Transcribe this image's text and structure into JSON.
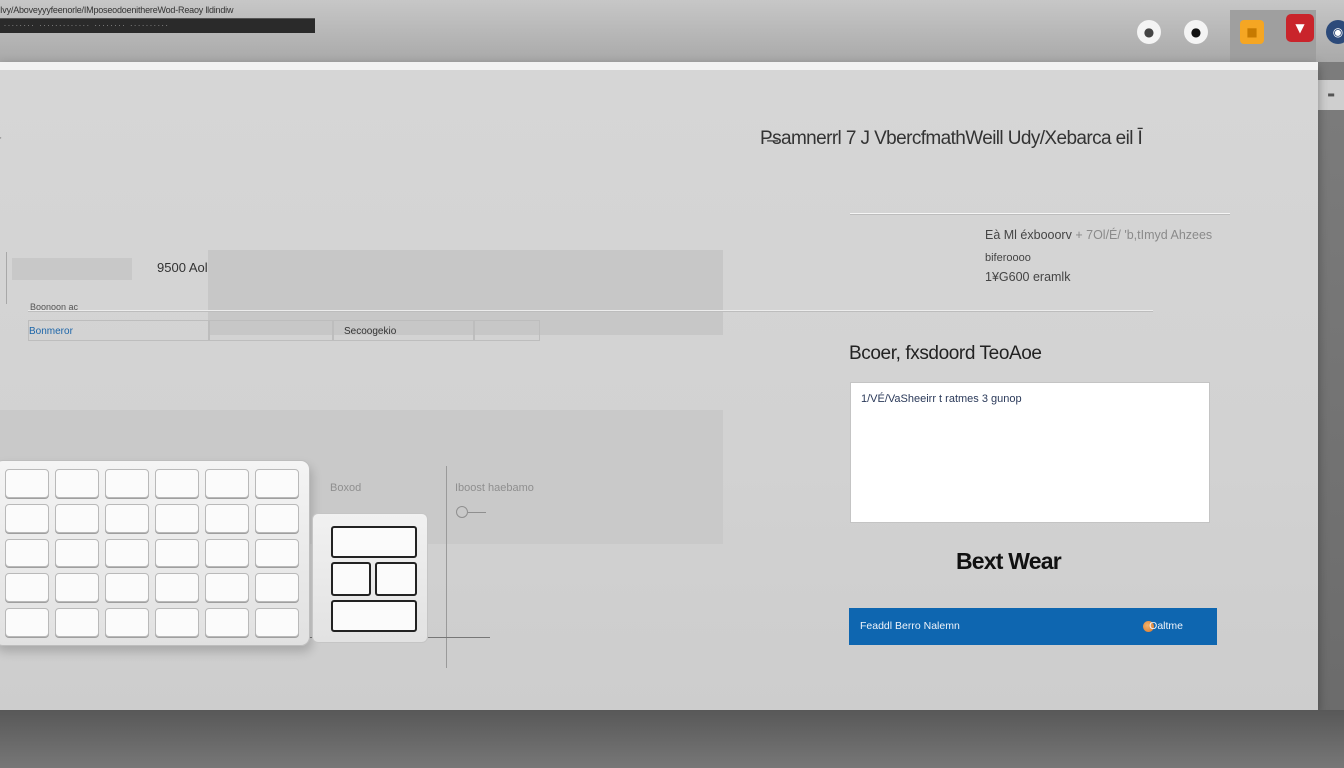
{
  "titlebar": {
    "title": "Ivy/Aboveyyyfeenorle/IMposeodoenithereWod-Reaoy lldindiw",
    "subtitle": "........ ............. ........ .........."
  },
  "tray": {
    "icons": [
      {
        "name": "chat-icon",
        "glyph": "●",
        "bg": "#f4f4f4",
        "fg": "#444"
      },
      {
        "name": "profile-icon",
        "glyph": "●",
        "bg": "#f4f4f4",
        "fg": "#111"
      },
      {
        "name": "package-icon",
        "glyph": "■",
        "bg": "#f5a623",
        "fg": "#c77a00"
      },
      {
        "name": "shield-icon",
        "glyph": "▼",
        "bg": "#c9242b",
        "fg": "#ffffff"
      },
      {
        "name": "eye-icon",
        "glyph": "◉",
        "bg": "#2c4a7a",
        "fg": "#ffffff"
      }
    ],
    "side_tab": "▬"
  },
  "window": {
    "heading": "P̶samnerrl  7 J  VbercfmathWeill Udy/Xebarca  eil  Ī",
    "edge_mark": "'"
  },
  "info": {
    "line1": "Eà Ml éxbooorv",
    "line1_faded": "+  7Ol/É/ 'b,tImyd Ahzees",
    "line2": "biferoooo",
    "line3": "1¥G600  eramlk"
  },
  "form": {
    "amount": "9500 Aol",
    "caption": "Boonoon ac",
    "tabs": [
      "Bonmeror",
      "",
      "Secoogekio",
      ""
    ]
  },
  "keyboard_panel": {
    "label1": "Boxod",
    "label2": "Iboost haebamo"
  },
  "dialog": {
    "title": "Bcoer, fxsdoord TeoAoe",
    "textbox_value": "1/VÉ/VaSheeirr t  ratmes 3 gunop",
    "big_label": "Bext Wear",
    "action_left": "Feaddl Berro Nalemn",
    "action_right": "Oaltme"
  }
}
